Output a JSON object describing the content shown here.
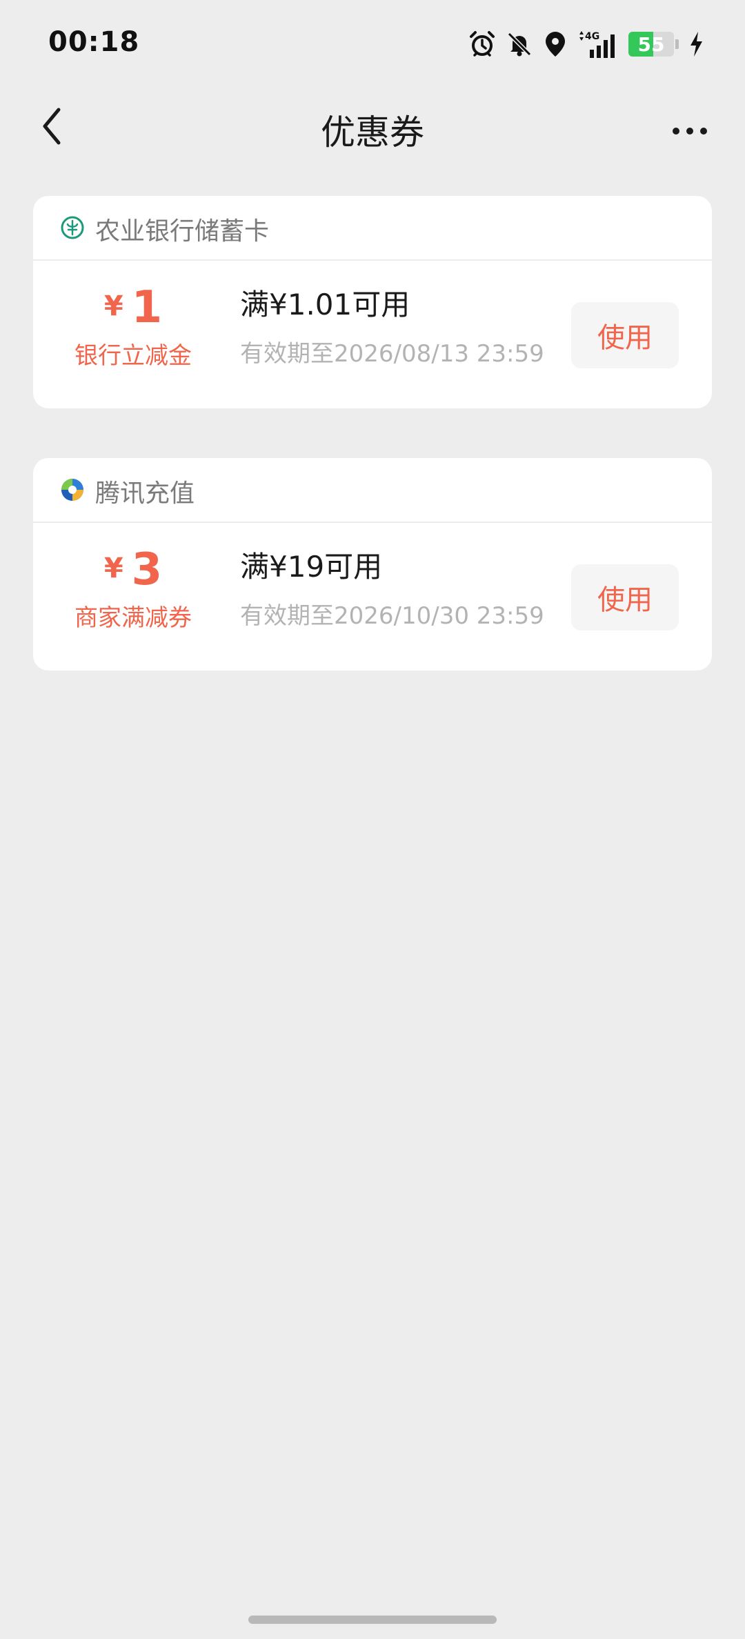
{
  "status_bar": {
    "time": "00:18",
    "network": "4G",
    "battery": "55",
    "battery_level_percent": 55,
    "icons": [
      "alarm-icon",
      "bell-muted-icon",
      "location-icon",
      "network-4g-icon",
      "signal-icon",
      "battery-icon",
      "charging-icon"
    ]
  },
  "nav": {
    "title": "优惠券",
    "back_icon": "chevron-left-icon",
    "more_icon": "more-horizontal-icon"
  },
  "coupons": [
    {
      "merchant": "农业银行储蓄卡",
      "merchant_icon": "abc-bank-logo",
      "currency": "¥",
      "amount": "1",
      "type_label": "银行立减金",
      "condition": "满¥1.01可用",
      "expiry": "有效期至2026/08/13 23:59",
      "button_label": "使用"
    },
    {
      "merchant": "腾讯充值",
      "merchant_icon": "tencent-recharge-logo",
      "currency": "¥",
      "amount": "3",
      "type_label": "商家满减券",
      "condition": "满¥19可用",
      "expiry": "有效期至2026/10/30 23:59",
      "button_label": "使用"
    }
  ],
  "colors": {
    "background": "#ededed",
    "card": "#ffffff",
    "accent": "#f0654b",
    "muted_text": "#b3b3b3",
    "merchant_text": "#7a7a7a",
    "battery_green": "#34c759"
  }
}
